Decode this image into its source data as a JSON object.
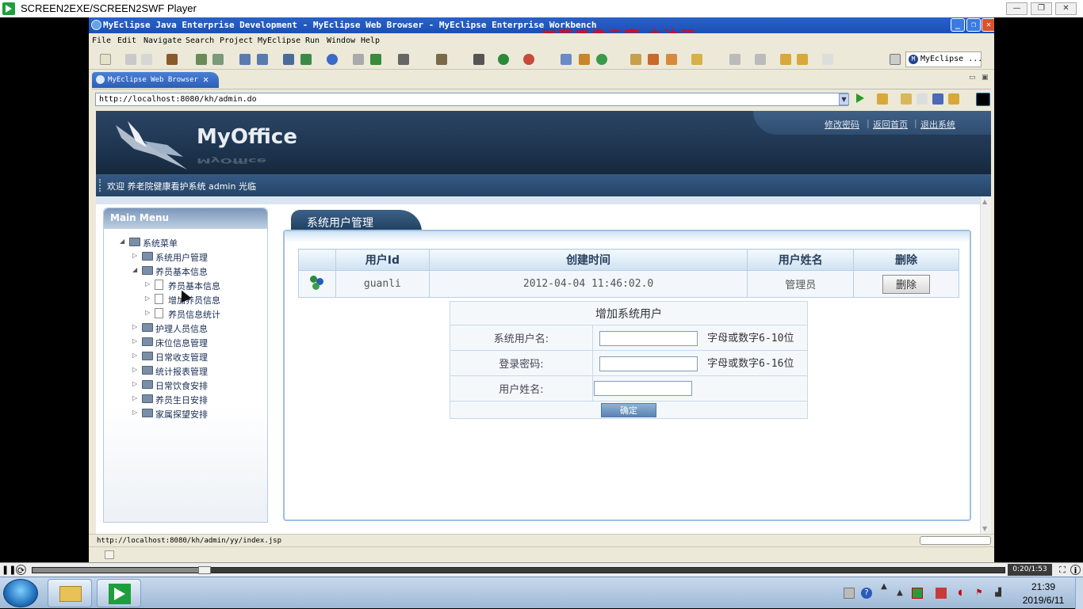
{
  "player": {
    "title": "SCREEN2EXE/SCREEN2SWF Player",
    "time": "0:20/1:53",
    "progress": 0.177
  },
  "eclipse": {
    "title": "MyEclipse Java Enterprise Development - MyEclipse Web Browser - MyEclipse Enterprise Workbench",
    "watermark": "屏幕录像专家  未注册",
    "menu": [
      "File",
      "Edit",
      "Navigate",
      "Search",
      "Project",
      "MyEclipse",
      "Run",
      "Window",
      "Help"
    ],
    "perspective": "MyEclipse ...",
    "tab_label": "MyEclipse Web Browser",
    "url": "http://localhost:8080/kh/admin.do",
    "status_url": "http://localhost:8080/kh/admin/yy/index.jsp"
  },
  "web": {
    "logo": "MyOffice",
    "header_links": [
      "修改密码",
      "返回首页",
      "退出系统"
    ],
    "welcome": "欢迎 养老院健康看护系统 admin 光临",
    "sidebar": {
      "title": "Main Menu",
      "root": "系统菜单",
      "items": [
        {
          "label": "系统用户管理",
          "level": 1,
          "kind": "folder",
          "expanded": false
        },
        {
          "label": "养员基本信息",
          "level": 1,
          "kind": "folder",
          "expanded": true
        },
        {
          "label": "养员基本信息",
          "level": 2,
          "kind": "doc",
          "expanded": false
        },
        {
          "label": "增加养员信息",
          "level": 2,
          "kind": "doc",
          "expanded": false
        },
        {
          "label": "养员信息统计",
          "level": 2,
          "kind": "doc",
          "expanded": false
        },
        {
          "label": "护理人员信息",
          "level": 1,
          "kind": "folder",
          "expanded": false
        },
        {
          "label": "床位信息管理",
          "level": 1,
          "kind": "folder",
          "expanded": false
        },
        {
          "label": "日常收支管理",
          "level": 1,
          "kind": "folder",
          "expanded": false
        },
        {
          "label": "统计报表管理",
          "level": 1,
          "kind": "folder",
          "expanded": false
        },
        {
          "label": "日常饮食安排",
          "level": 1,
          "kind": "folder",
          "expanded": false
        },
        {
          "label": "养员生日安排",
          "level": 1,
          "kind": "folder",
          "expanded": false
        },
        {
          "label": "家属探望安排",
          "level": 1,
          "kind": "folder",
          "expanded": false
        }
      ]
    },
    "main": {
      "tab_title": "系统用户管理",
      "table": {
        "headers": [
          "",
          "用户Id",
          "创建时间",
          "用户姓名",
          "删除"
        ],
        "rows": [
          {
            "id": "guanli",
            "created": "2012-04-04 11:46:02.0",
            "name": "管理员",
            "action": "删除"
          }
        ]
      },
      "add_form": {
        "caption": "增加系统用户",
        "username_label": "系统用户名:",
        "username_hint": "字母或数字6-10位",
        "username_value": "",
        "password_label": "登录密码:",
        "password_hint": "字母或数字6-16位",
        "password_value": "",
        "realname_label": "用户姓名:",
        "realname_value": "",
        "submit_label": "确定"
      }
    }
  },
  "taskbar": {
    "time": "21:39",
    "date": "2019/6/11"
  }
}
